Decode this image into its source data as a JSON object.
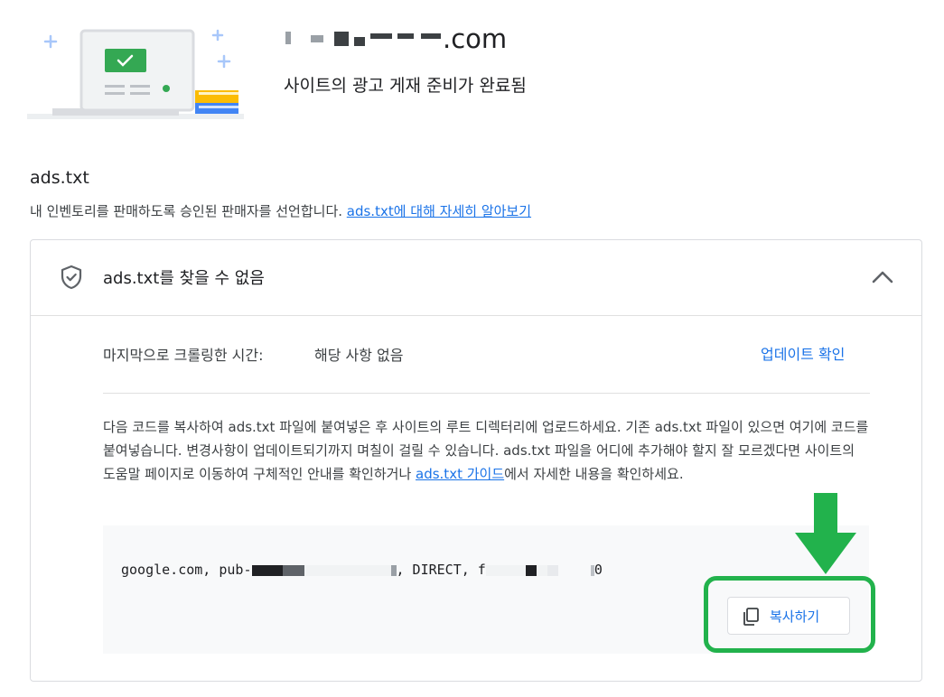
{
  "header": {
    "domain_suffix": ".com",
    "status": "사이트의 광고 게재 준비가 완료됨"
  },
  "adstxt_section": {
    "title": "ads.txt",
    "description_prefix": "내 인벤토리를 판매하도록 승인된 판매자를 선언합니다. ",
    "learn_more_link": "ads.txt에 대해 자세히 알아보기"
  },
  "card": {
    "status_title": "ads.txt를 찾을 수 없음",
    "crawl_label": "마지막으로 크롤링한 시간:",
    "crawl_value": "해당 사항 없음",
    "update_link": "업데이트 확인",
    "instructions_text": "다음 코드를 복사하여 ads.txt 파일에 붙여넣은 후 사이트의 루트 디렉터리에 업로드하세요. 기존 ads.txt 파일이 있으면 여기에 코드를 붙여넣습니다. 변경사항이 업데이트되기까지 며칠이 걸릴 수 있습니다. ads.txt 파일을 어디에 추가해야 할지 잘 모르겠다면 사이트의 도움말 페이지로 이동하여 구체적인 안내를 확인하거나 ",
    "guide_link": "ads.txt 가이드",
    "instructions_suffix": "에서 자세한 내용을 확인하세요.",
    "code_prefix": "google.com, pub-",
    "code_middle": ", DIRECT, f",
    "code_end": "0",
    "copy_button": "복사하기"
  },
  "colors": {
    "link_blue": "#1a73e8",
    "annotation_green": "#22b24c",
    "code_background": "#f8f9fa",
    "border": "#dadce0"
  },
  "icons": [
    "shield-check-icon",
    "chevron-up-icon",
    "copy-icon",
    "down-arrow-icon"
  ]
}
